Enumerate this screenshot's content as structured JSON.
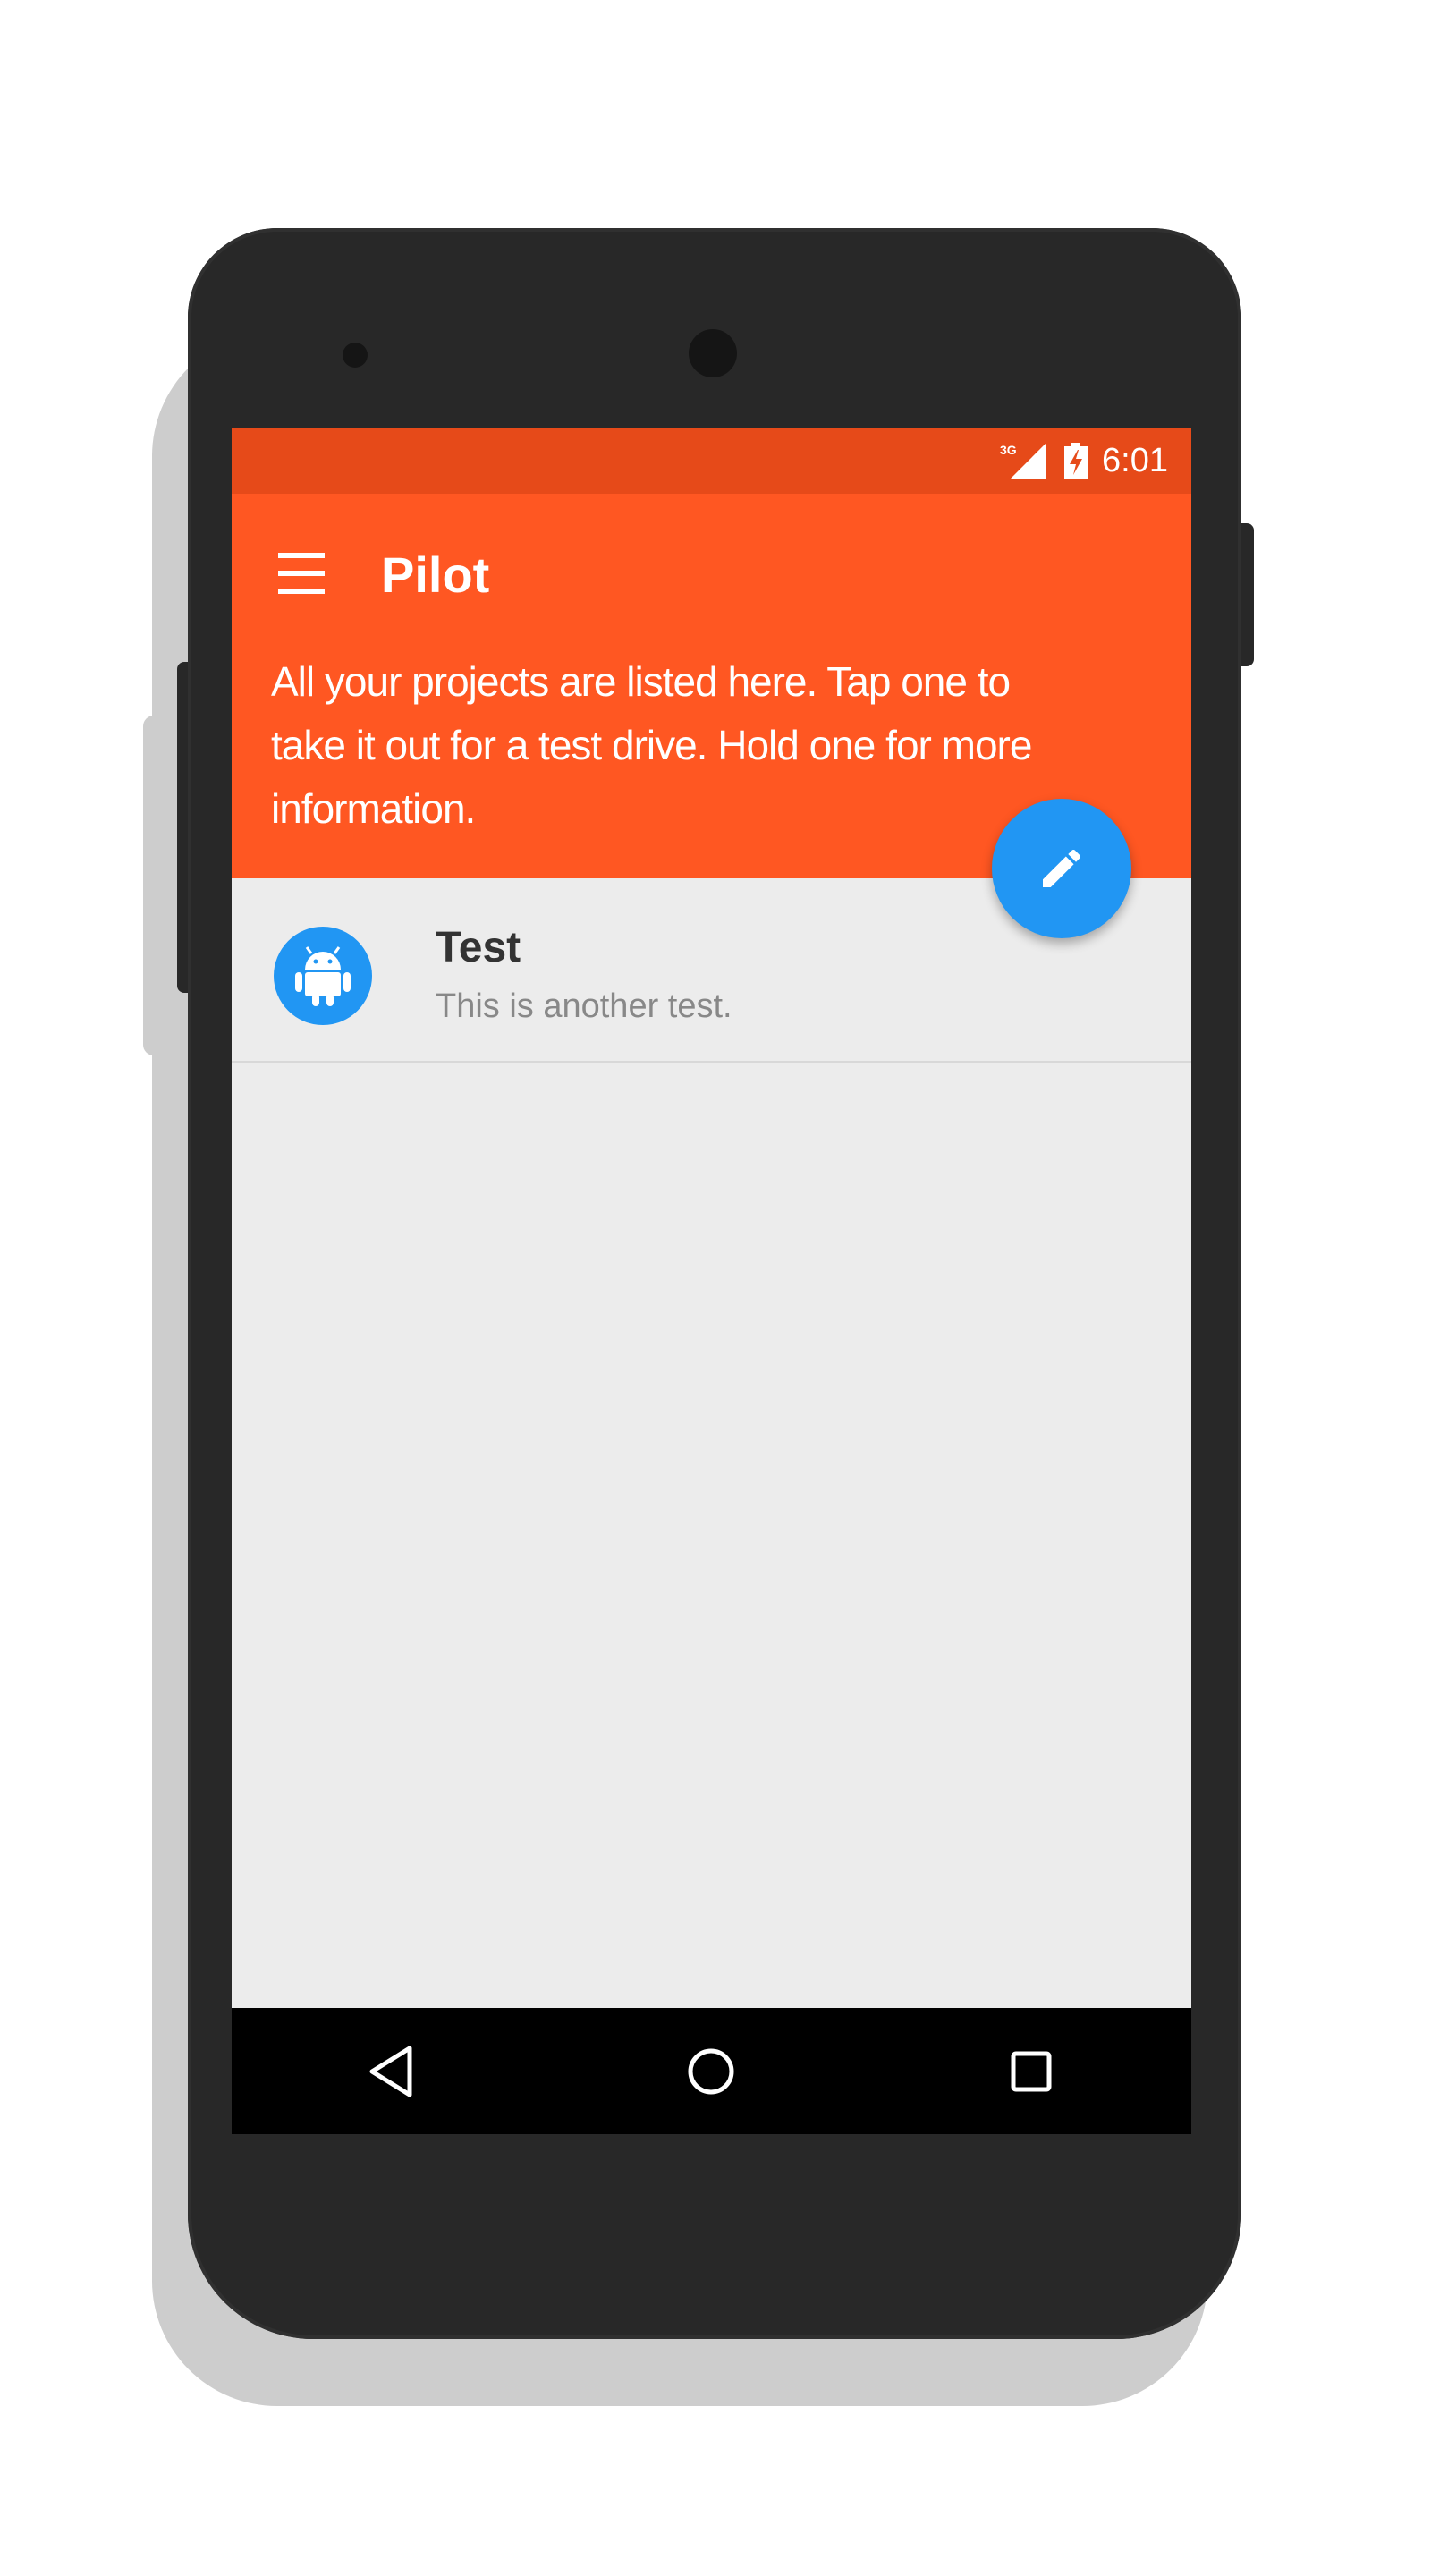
{
  "status_bar": {
    "network_label": "3G",
    "time": "6:01",
    "signal_icon": "signal-3g-icon",
    "battery_icon": "battery-charging-icon"
  },
  "app_bar": {
    "menu_icon": "hamburger-menu-icon",
    "title": "Pilot",
    "description": "All your projects are listed here. Tap one to take it out for a test drive. Hold one for more information.",
    "color": "#ff5722",
    "status_color": "#e64a19"
  },
  "fab": {
    "icon": "pencil-edit-icon",
    "color": "#2196f3"
  },
  "projects": [
    {
      "icon": "android-icon",
      "title": "Test",
      "subtitle": "This is another test."
    }
  ],
  "nav_bar": {
    "back_icon": "back-triangle-icon",
    "home_icon": "home-circle-icon",
    "recents_icon": "recents-square-icon"
  }
}
